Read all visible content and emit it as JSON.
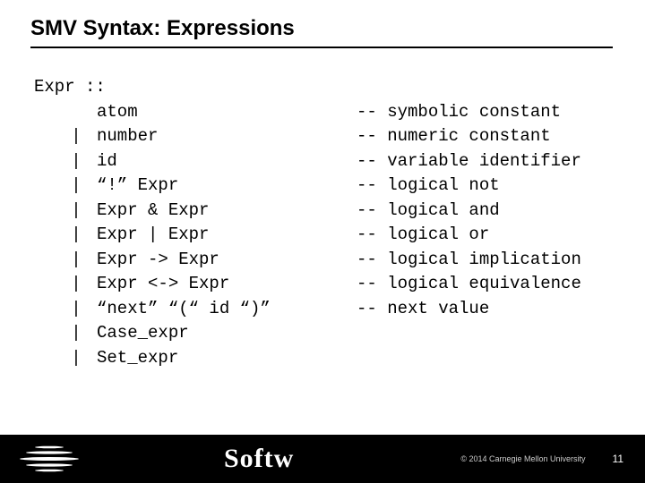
{
  "title": "SMV Syntax: Expressions",
  "grammar": {
    "header": "Expr ::",
    "rows": [
      {
        "bar": "",
        "syntax": "atom",
        "comment": "-- symbolic constant"
      },
      {
        "bar": "|",
        "syntax": "number",
        "comment": "-- numeric constant"
      },
      {
        "bar": "|",
        "syntax": "id",
        "comment": "-- variable identifier"
      },
      {
        "bar": "|",
        "syntax": "“!” Expr",
        "comment": "-- logical not"
      },
      {
        "bar": "|",
        "syntax": "Expr & Expr",
        "comment": "-- logical and"
      },
      {
        "bar": "|",
        "syntax": "Expr | Expr",
        "comment": "-- logical or"
      },
      {
        "bar": "|",
        "syntax": "Expr -> Expr",
        "comment": "-- logical implication"
      },
      {
        "bar": "|",
        "syntax": "Expr <-> Expr",
        "comment": "-- logical equivalence"
      },
      {
        "bar": "|",
        "syntax": "“next” “(“ id “)”",
        "comment": "-- next value"
      },
      {
        "bar": "|",
        "syntax": "Case_expr",
        "comment": ""
      },
      {
        "bar": "|",
        "syntax": "Set_expr",
        "comment": ""
      }
    ]
  },
  "footer": {
    "brand": "Softw",
    "copyright": "© 2014 Carnegie Mellon University",
    "page": "11"
  }
}
